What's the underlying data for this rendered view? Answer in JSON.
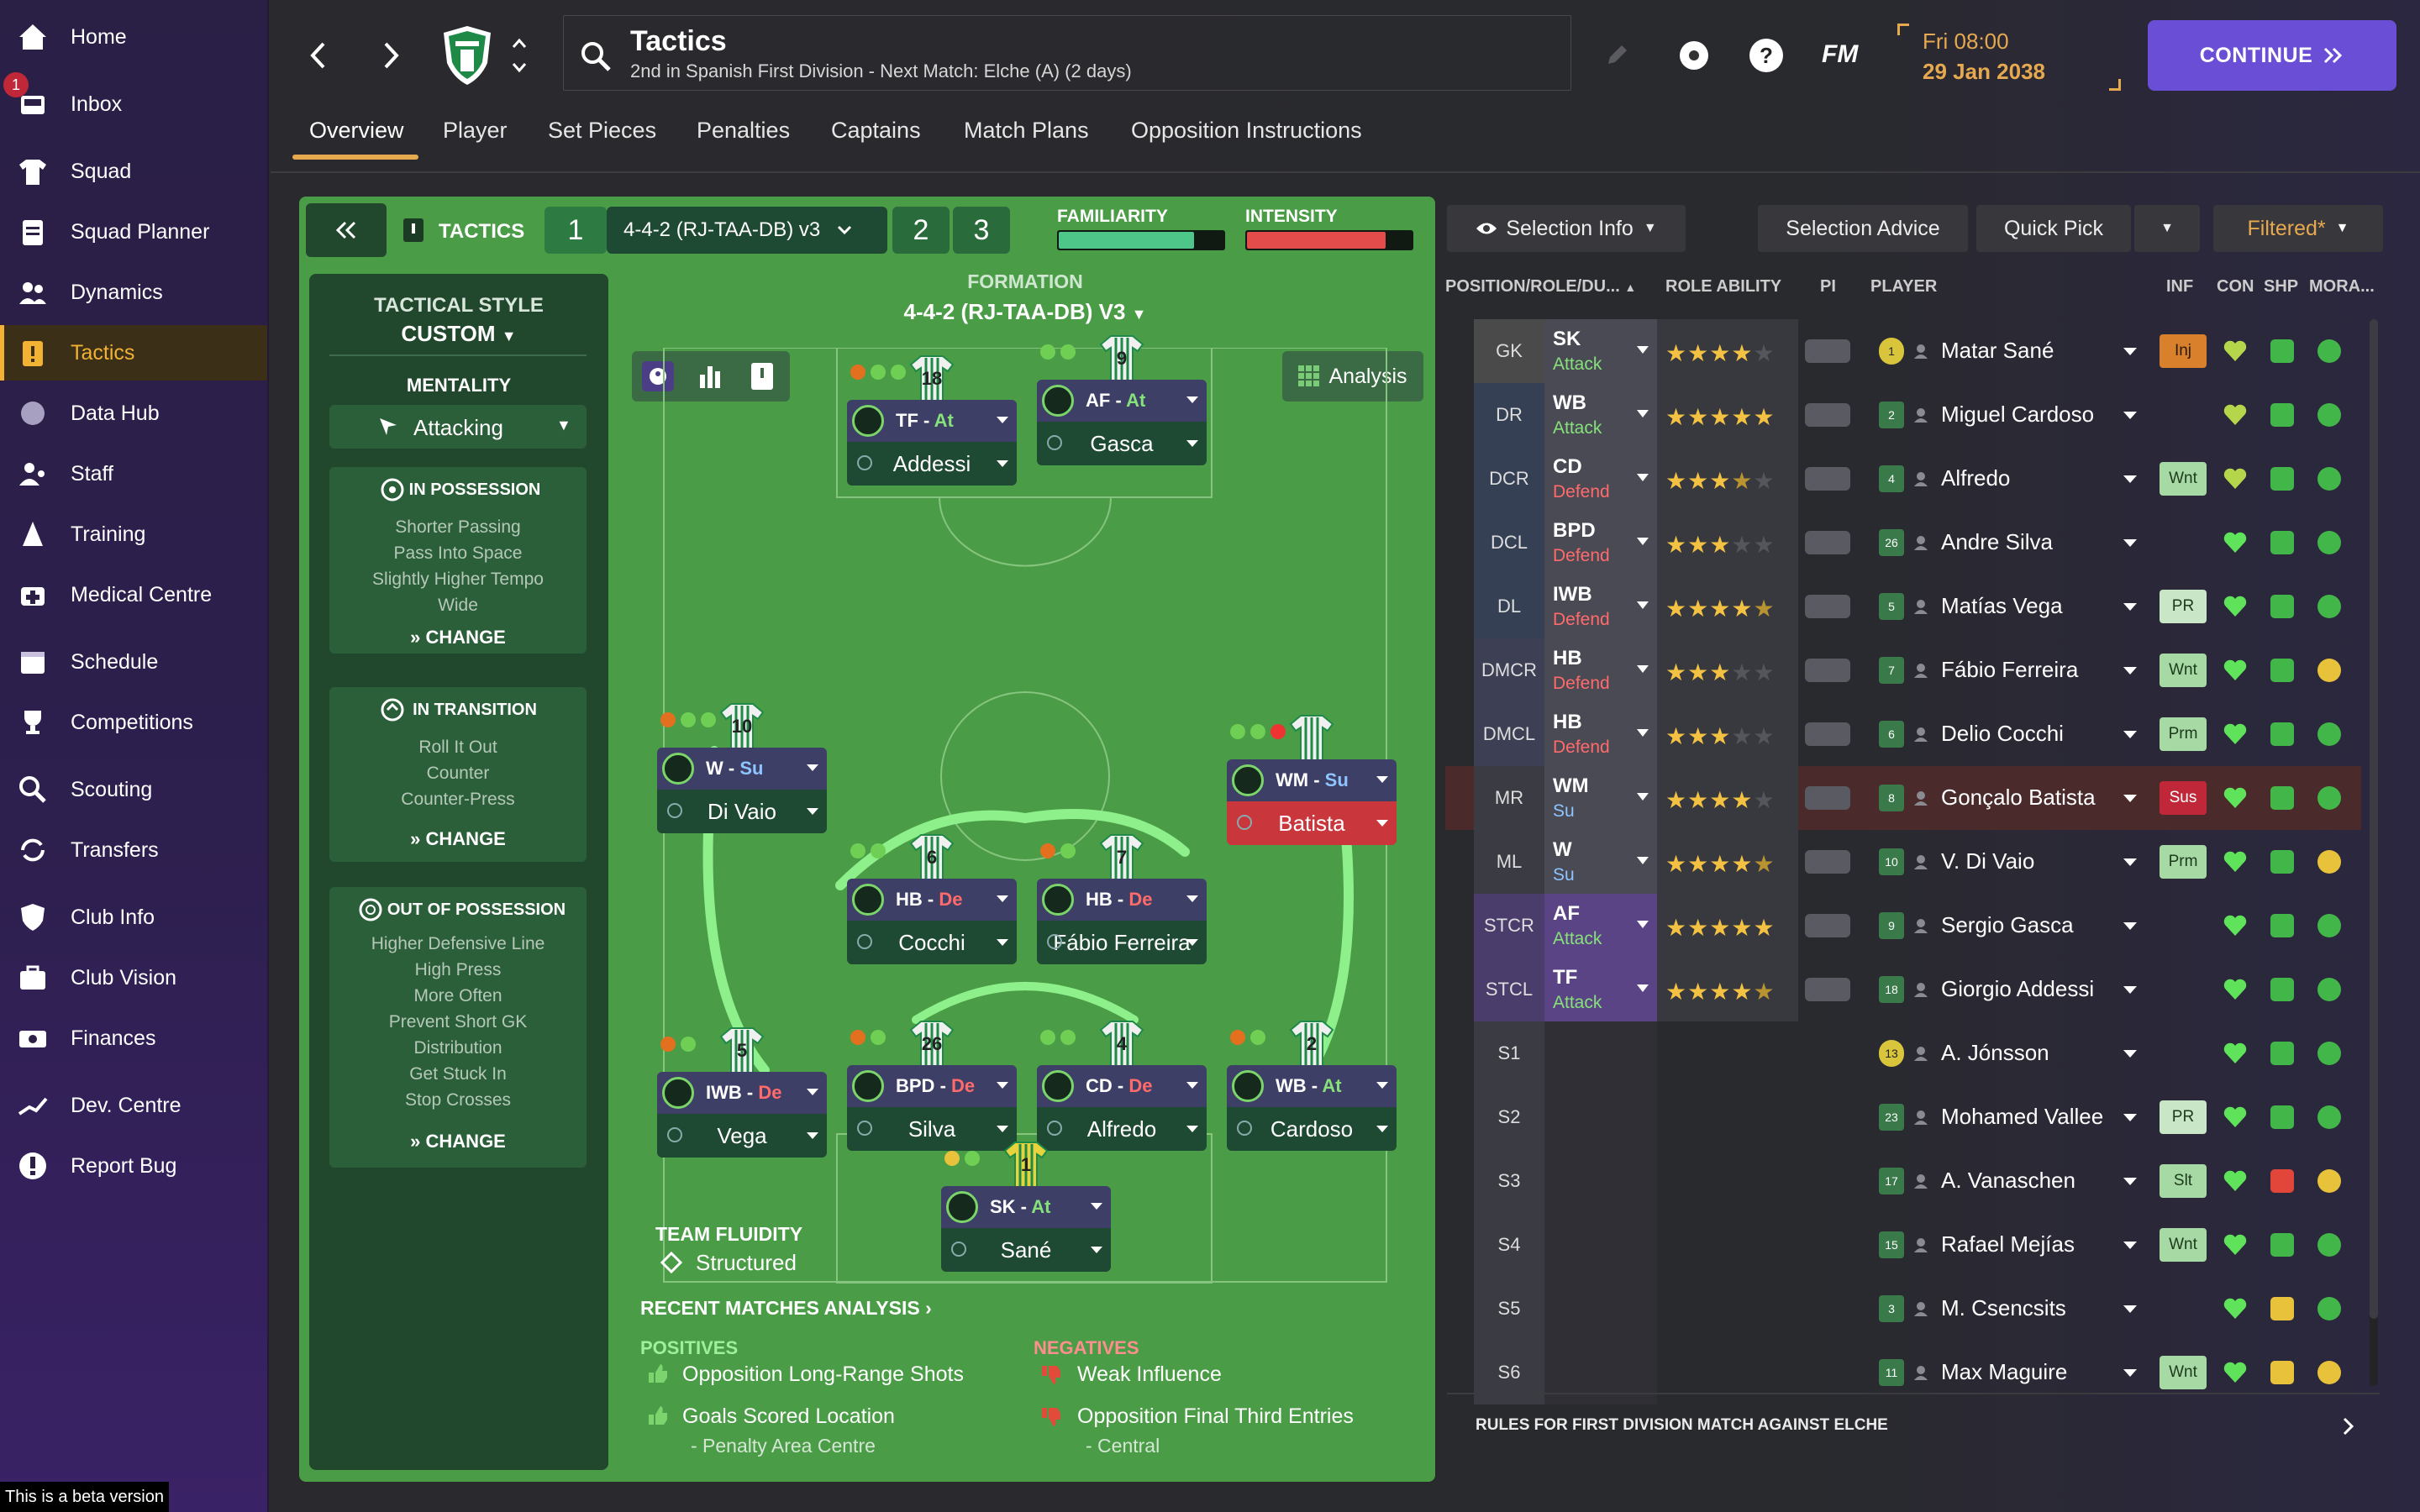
{
  "sidebar": {
    "items": [
      {
        "label": "Home",
        "icon": "home-icon"
      },
      {
        "label": "Inbox",
        "icon": "inbox-icon"
      },
      {
        "label": "Squad",
        "icon": "shirt-icon"
      },
      {
        "label": "Squad Planner",
        "icon": "clipboard-icon"
      },
      {
        "label": "Dynamics",
        "icon": "people-icon"
      },
      {
        "label": "Tactics",
        "icon": "tactics-board-icon"
      },
      {
        "label": "Data Hub",
        "icon": "globe-icon"
      },
      {
        "label": "Staff",
        "icon": "staff-icon"
      },
      {
        "label": "Training",
        "icon": "training-cone-icon"
      },
      {
        "label": "Medical Centre",
        "icon": "medical-kit-icon"
      },
      {
        "label": "Schedule",
        "icon": "calendar-icon"
      },
      {
        "label": "Competitions",
        "icon": "trophy-icon"
      },
      {
        "label": "Scouting",
        "icon": "magnifier-icon"
      },
      {
        "label": "Transfers",
        "icon": "transfer-arrows-icon"
      },
      {
        "label": "Club Info",
        "icon": "shield-icon"
      },
      {
        "label": "Club Vision",
        "icon": "briefcase-icon"
      },
      {
        "label": "Finances",
        "icon": "money-icon"
      },
      {
        "label": "Dev. Centre",
        "icon": "growth-icon"
      },
      {
        "label": "Report Bug",
        "icon": "alert-icon"
      }
    ],
    "inbox_badge": "1",
    "beta_note": "This is a beta version"
  },
  "header": {
    "title": "Tactics",
    "subtitle": "2nd in Spanish First Division - Next Match: Elche (A) (2 days)",
    "day": "Fri 08:00",
    "date": "29 Jan 2038",
    "fm": "FM",
    "continue": "CONTINUE"
  },
  "tabs": [
    "Overview",
    "Player",
    "Set Pieces",
    "Penalties",
    "Captains",
    "Match Plans",
    "Opposition Instructions"
  ],
  "tactics_bar": {
    "label": "TACTICS",
    "slot1": "1",
    "tactic_name": "4-4-2 (RJ-TAA-DB) v3",
    "slot2": "2",
    "slot3": "3",
    "familiarity_label": "FAMILIARITY",
    "intensity_label": "INTENSITY",
    "familiarity": 0.82,
    "intensity": 0.84
  },
  "style": {
    "title": "TACTICAL STYLE",
    "value": "CUSTOM",
    "mentality_label": "MENTALITY",
    "mentality": "Attacking",
    "in_possession": {
      "title": "IN POSSESSION",
      "lines": [
        "Shorter Passing",
        "Pass Into Space",
        "Slightly Higher Tempo",
        "Wide"
      ]
    },
    "in_transition": {
      "title": "IN TRANSITION",
      "lines": [
        "Roll It Out",
        "Counter",
        "Counter-Press"
      ]
    },
    "out_of_possession": {
      "title": "OUT OF POSSESSION",
      "lines": [
        "Higher Defensive Line",
        "High Press",
        "More Often",
        "Prevent Short GK",
        "Distribution",
        "Get Stuck In",
        "Stop Crosses"
      ]
    },
    "change": "CHANGE"
  },
  "formation": {
    "label": "FORMATION",
    "value": "4-4-2 (RJ-TAA-DB) V3",
    "analysis": "Analysis",
    "fluidity_label": "TEAM FLUIDITY",
    "fluidity": "Structured"
  },
  "players_pitch": [
    {
      "num": "18",
      "role": "TF",
      "duty": "At",
      "name": "Addessi"
    },
    {
      "num": "9",
      "role": "AF",
      "duty": "At",
      "name": "Gasca"
    },
    {
      "num": "10",
      "role": "W",
      "duty": "Su",
      "name": "Di Vaio"
    },
    {
      "num": "",
      "role": "WM",
      "duty": "Su",
      "name": "Batista"
    },
    {
      "num": "6",
      "role": "HB",
      "duty": "De",
      "name": "Cocchi"
    },
    {
      "num": "7",
      "role": "HB",
      "duty": "De",
      "name": "Fábio Ferreira"
    },
    {
      "num": "5",
      "role": "IWB",
      "duty": "De",
      "name": "Vega"
    },
    {
      "num": "26",
      "role": "BPD",
      "duty": "De",
      "name": "Silva"
    },
    {
      "num": "4",
      "role": "CD",
      "duty": "De",
      "name": "Alfredo"
    },
    {
      "num": "2",
      "role": "WB",
      "duty": "At",
      "name": "Cardoso"
    },
    {
      "num": "1",
      "role": "SK",
      "duty": "At",
      "name": "Sané"
    }
  ],
  "analysis": {
    "title": "RECENT MATCHES ANALYSIS",
    "positives_label": "POSITIVES",
    "negatives_label": "NEGATIVES",
    "positives": [
      "Opposition Long-Range Shots",
      "Goals Scored Location",
      "- Penalty Area Centre"
    ],
    "negatives": [
      "Weak Influence",
      "Opposition Final Third Entries",
      "- Central"
    ]
  },
  "selection": {
    "info": "Selection Info",
    "advice": "Selection Advice",
    "quick_pick": "Quick Pick",
    "filtered": "Filtered*",
    "headers": [
      "POSITION/ROLE/DU...",
      "ROLE ABILITY",
      "PI",
      "PLAYER",
      "INF",
      "CON",
      "SHP",
      "MORA..."
    ],
    "rows": [
      {
        "pos": "GK",
        "role": "SK",
        "duty": "Attack",
        "stars": 4,
        "num": "1",
        "name": "Matar Sané",
        "inf": "Inj"
      },
      {
        "pos": "DR",
        "role": "WB",
        "duty": "Attack",
        "stars": 5,
        "num": "2",
        "name": "Miguel Cardoso",
        "inf": ""
      },
      {
        "pos": "DCR",
        "role": "CD",
        "duty": "Defend",
        "stars": 3.5,
        "num": "4",
        "name": "Alfredo",
        "inf": "Wnt"
      },
      {
        "pos": "DCL",
        "role": "BPD",
        "duty": "Defend",
        "stars": 3,
        "num": "26",
        "name": "Andre Silva",
        "inf": ""
      },
      {
        "pos": "DL",
        "role": "IWB",
        "duty": "Defend",
        "stars": 4.5,
        "num": "5",
        "name": "Matías Vega",
        "inf": "PR"
      },
      {
        "pos": "DMCR",
        "role": "HB",
        "duty": "Defend",
        "stars": 3,
        "num": "7",
        "name": "Fábio Ferreira",
        "inf": "Wnt"
      },
      {
        "pos": "DMCL",
        "role": "HB",
        "duty": "Defend",
        "stars": 3,
        "num": "6",
        "name": "Delio Cocchi",
        "inf": "Prm"
      },
      {
        "pos": "MR",
        "role": "WM",
        "duty": "Su",
        "stars": 4,
        "num": "8",
        "name": "Gonçalo Batista",
        "inf": "Sus"
      },
      {
        "pos": "ML",
        "role": "W",
        "duty": "Su",
        "stars": 4.5,
        "num": "10",
        "name": "V. Di Vaio",
        "inf": "Prm"
      },
      {
        "pos": "STCR",
        "role": "AF",
        "duty": "Attack",
        "stars": 5,
        "num": "9",
        "name": "Sergio Gasca",
        "inf": ""
      },
      {
        "pos": "STCL",
        "role": "TF",
        "duty": "Attack",
        "stars": 4.5,
        "num": "18",
        "name": "Giorgio Addessi",
        "inf": ""
      },
      {
        "pos": "S1",
        "role": "",
        "duty": "",
        "stars": 0,
        "num": "13",
        "name": "A. Jónsson",
        "inf": ""
      },
      {
        "pos": "S2",
        "role": "",
        "duty": "",
        "stars": 0,
        "num": "23",
        "name": "Mohamed Vallee",
        "inf": "PR"
      },
      {
        "pos": "S3",
        "role": "",
        "duty": "",
        "stars": 0,
        "num": "17",
        "name": "A. Vanaschen",
        "inf": "Slt"
      },
      {
        "pos": "S4",
        "role": "",
        "duty": "",
        "stars": 0,
        "num": "15",
        "name": "Rafael Mejías",
        "inf": "Wnt"
      },
      {
        "pos": "S5",
        "role": "",
        "duty": "",
        "stars": 0,
        "num": "3",
        "name": "M. Csencsits",
        "inf": ""
      },
      {
        "pos": "S6",
        "role": "",
        "duty": "",
        "stars": 0,
        "num": "11",
        "name": "Max Maguire",
        "inf": "Wnt"
      }
    ],
    "rules": "RULES FOR FIRST DIVISION MATCH AGAINST ELCHE"
  },
  "colors": {
    "accent": "#e7a94f",
    "continue": "#6a4fd6",
    "pitch": "#4a9d46",
    "danger": "#c0283a"
  }
}
